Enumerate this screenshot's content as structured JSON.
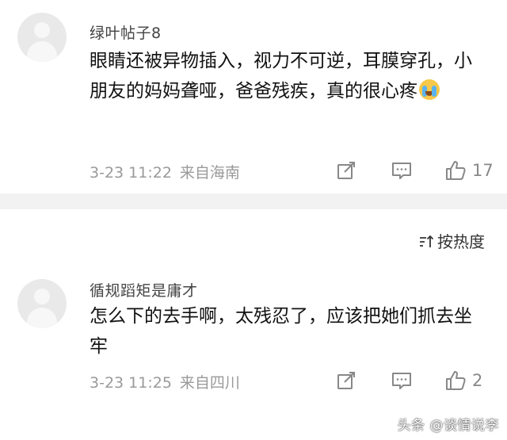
{
  "comments": [
    {
      "username": "绿叶帖子8",
      "content": "眼睛还被异物插入，视力不可逆，耳膜穿孔，小朋友的妈妈聋哑，爸爸残疾，真的很心疼",
      "emoji": "crying-face-icon",
      "date": "3-23 11:22",
      "location": "来自海南",
      "likes": "17"
    },
    {
      "username": "循规蹈矩是庸才",
      "content": "怎么下的去手啊，太残忍了，应该把她们抓去坐牢",
      "date": "3-23 11:25",
      "location": "来自四川",
      "likes": "2"
    }
  ],
  "sort": {
    "label": "按热度"
  },
  "watermark": "头条 @谈情说李",
  "colors": {
    "meta": "#9a9a9a",
    "divider": "#f2f2f2",
    "emoji_face": "#f7c84a"
  }
}
